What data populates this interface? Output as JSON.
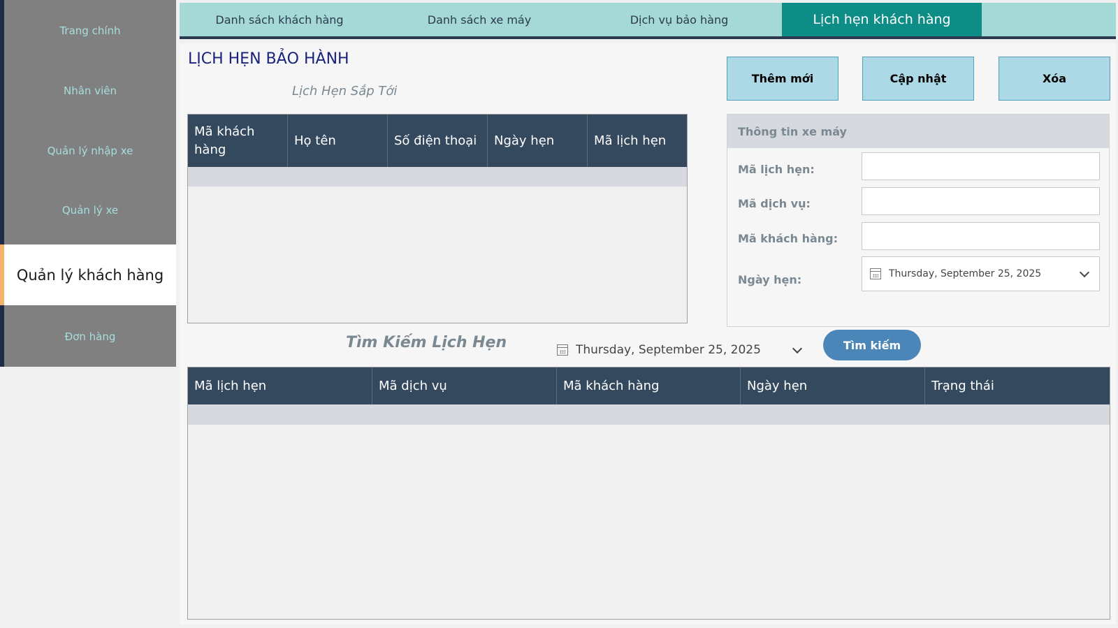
{
  "sidebar": {
    "items": [
      {
        "label": "Trang chính"
      },
      {
        "label": "Nhân viên"
      },
      {
        "label": "Quản lý nhập xe"
      },
      {
        "label": "Quản lý xe"
      },
      {
        "label": "Quản lý khách hàng",
        "active": true
      },
      {
        "label": "Đơn hàng"
      }
    ]
  },
  "tabs": [
    {
      "label": "Danh sách khách hàng"
    },
    {
      "label": "Danh sách xe máy"
    },
    {
      "label": "Dịch vụ bảo hàng"
    },
    {
      "label": "Lịch hẹn khách hàng",
      "active": true
    }
  ],
  "page": {
    "title": "LỊCH HẸN BẢO HÀNH",
    "upcoming_subtitle": "Lịch Hẹn Sắp Tới",
    "search_title": "Tìm Kiếm Lịch Hẹn"
  },
  "actions": {
    "add_label": "Thêm mới",
    "update_label": "Cập nhật",
    "delete_label": "Xóa",
    "search_label": "Tìm kiếm"
  },
  "upcoming_table": {
    "columns": [
      "Mã khách hàng",
      "Họ tên",
      "Số điện thoại",
      "Ngày hẹn",
      "Mã lịch hẹn"
    ]
  },
  "info_panel": {
    "header": "Thông tin xe máy",
    "fields": {
      "appointment_id_label": "Mã lịch hẹn:",
      "service_id_label": "Mã dịch vụ:",
      "customer_id_label": "Mã khách hàng:",
      "date_label": "Ngày hẹn:",
      "appointment_id_value": "",
      "service_id_value": "",
      "customer_id_value": "",
      "date_value": "Thursday, September 25, 2025"
    }
  },
  "search": {
    "date_value": "Thursday, September 25, 2025"
  },
  "results_table": {
    "columns": [
      "Mã lịch hẹn",
      "Mã dịch vụ",
      "Mã khách hàng",
      "Ngày hẹn",
      "Trạng thái"
    ]
  },
  "colors": {
    "sidebar_bg": "#808080",
    "sidebar_text": "#a8dede",
    "tab_bar_bg": "#a5d9d6",
    "tab_active_bg": "#0e8c86",
    "grid_header_bg": "#34495e",
    "button_bg": "#add8e6",
    "search_button_bg": "#4a86b8",
    "title_color": "#1a237e"
  },
  "icons": {
    "date_picker": "calendar-icon",
    "dropdown": "chevron-down-icon"
  }
}
